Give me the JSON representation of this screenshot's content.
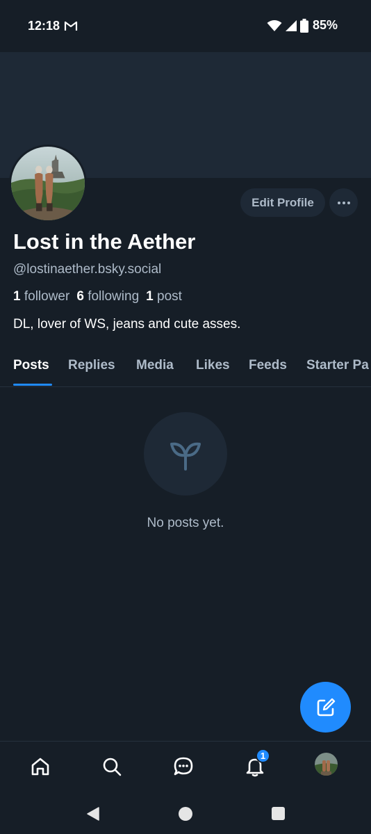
{
  "status_bar": {
    "time": "12:18",
    "battery": "85%"
  },
  "profile": {
    "display_name": "Lost in the Aether",
    "handle": "@lostinaether.bsky.social",
    "stats": {
      "followers_count": "1",
      "followers_label": "follower",
      "following_count": "6",
      "following_label": "following",
      "posts_count": "1",
      "posts_label": "post"
    },
    "bio": "DL, lover of WS, jeans and cute asses.",
    "edit_button": "Edit Profile"
  },
  "tabs": [
    {
      "label": "Posts",
      "active": true
    },
    {
      "label": "Replies"
    },
    {
      "label": "Media"
    },
    {
      "label": "Likes"
    },
    {
      "label": "Feeds"
    },
    {
      "label": "Starter Pa"
    }
  ],
  "empty_state": {
    "icon": "sprout-icon",
    "text": "No posts yet."
  },
  "bottom_nav": {
    "items": [
      "home-icon",
      "search-icon",
      "chat-icon",
      "bell-icon",
      "profile-avatar"
    ],
    "notifications_badge": "1"
  },
  "colors": {
    "background": "#161e27",
    "banner": "#1e2936",
    "accent": "#208bfe",
    "muted_text": "#aebbc9"
  }
}
